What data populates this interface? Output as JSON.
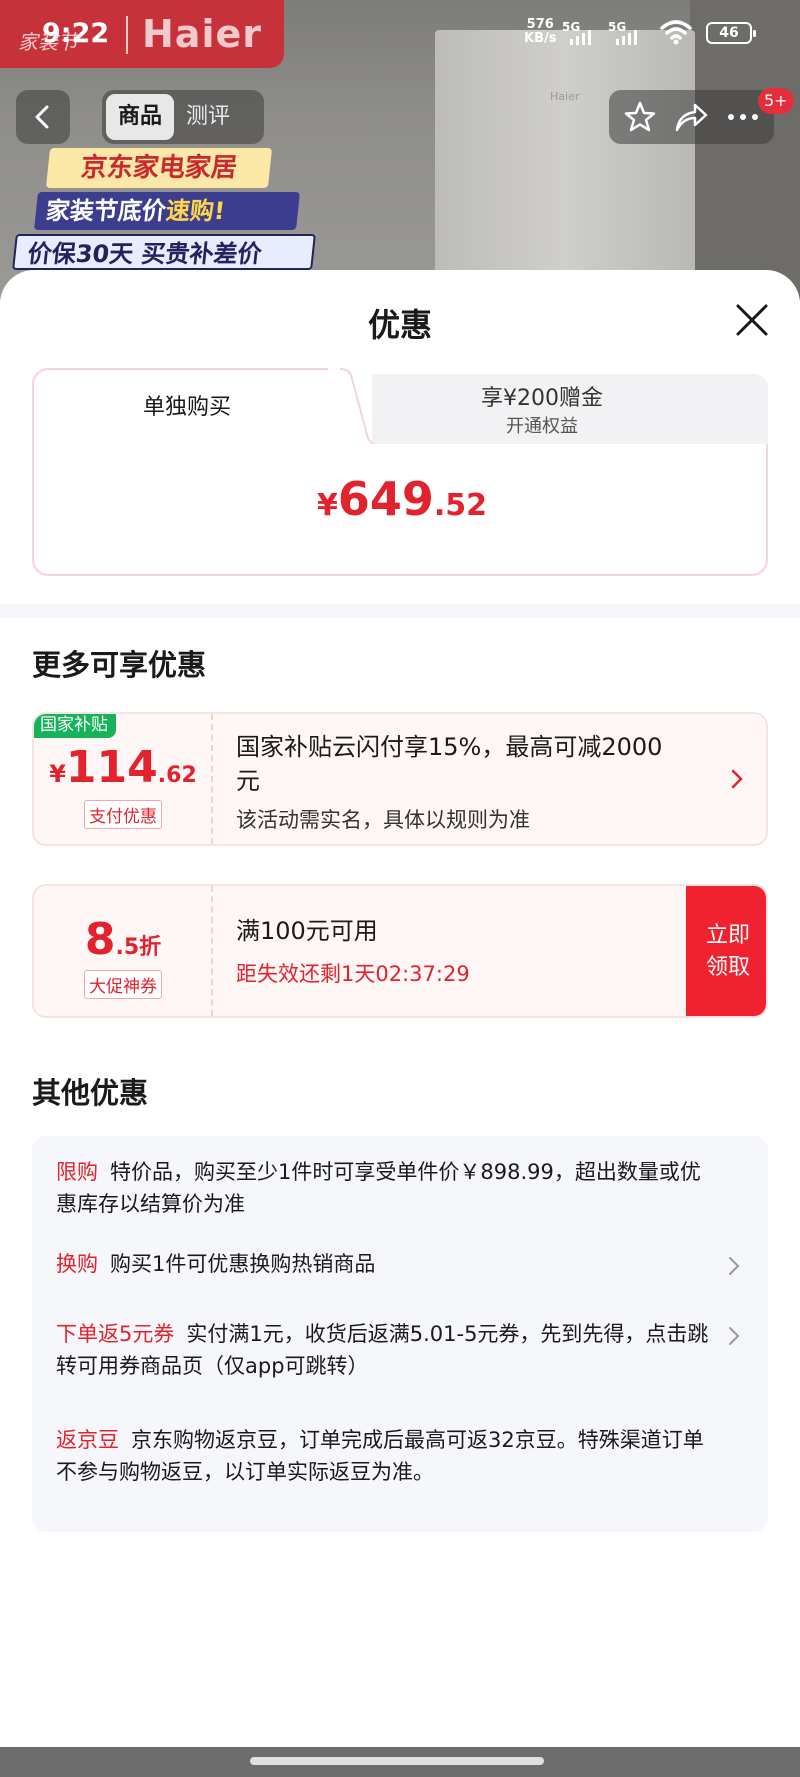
{
  "status_bar": {
    "time": "9:22",
    "net_speed_value": "576",
    "net_speed_unit": "KB/s",
    "sim1": "5G",
    "sim2": "5G",
    "battery": "46"
  },
  "backdrop": {
    "brand_small": "家装节",
    "brand_big": "Haier",
    "fridge_logo": "Haier",
    "promo_line1": "京东家电家居",
    "promo_line2_a": "家装节底价",
    "promo_line2_b": "速购!",
    "promo_line3": "价保30天 买贵补差价"
  },
  "nav": {
    "tabs": [
      {
        "label": "商品",
        "active": true
      },
      {
        "label": "测评",
        "active": false
      }
    ],
    "badge": "5+",
    "icons": [
      "back-icon",
      "star-icon",
      "share-icon",
      "more-icon"
    ]
  },
  "sheet": {
    "title": "优惠",
    "purchase_tabs": {
      "active_label": "单独购买",
      "inactive_line1": "享¥200赠金",
      "inactive_line2": "开通权益"
    },
    "price": {
      "currency": "¥",
      "integer": "649",
      "decimal": ".52"
    },
    "more_title": "更多可享优惠",
    "coupons": [
      {
        "flag": "国家补贴",
        "currency": "¥",
        "amount_int": "114",
        "amount_dec": ".62",
        "tag": "支付优惠",
        "desc_main": "国家补贴云闪付享15%，最高可减2000元",
        "desc_sub": "该活动需实名，具体以规则为准"
      },
      {
        "amount_int": "8",
        "amount_dec": ".5折",
        "tag": "大促神券",
        "desc_main": "满100元可用",
        "desc_sub": "距失效还剩1天02:37:29",
        "button_line1": "立即",
        "button_line2": "领取"
      }
    ],
    "other_title": "其他优惠",
    "other_items": [
      {
        "key": "限购",
        "text": "特价品，购买至少1件时可享受单件价￥898.99，超出数量或优惠库存以结算价为准"
      },
      {
        "key": "换购",
        "text": "购买1件可优惠换购热销商品"
      },
      {
        "key": "下单返5元券",
        "text": "实付满1元，收货后返满5.01-5元券，先到先得，点击跳转可用券商品页（仅app可跳转）"
      },
      {
        "key": "返京豆",
        "text": "京东购物返京豆，订单完成后最高可返32京豆。特殊渠道订单不参与购物返豆，以订单实际返豆为准。"
      }
    ]
  },
  "colors": {
    "accent_red": "#e2232e",
    "claim_red": "#f0222f",
    "subsidy_green": "#17b35a",
    "brand_red": "#c7323a"
  }
}
